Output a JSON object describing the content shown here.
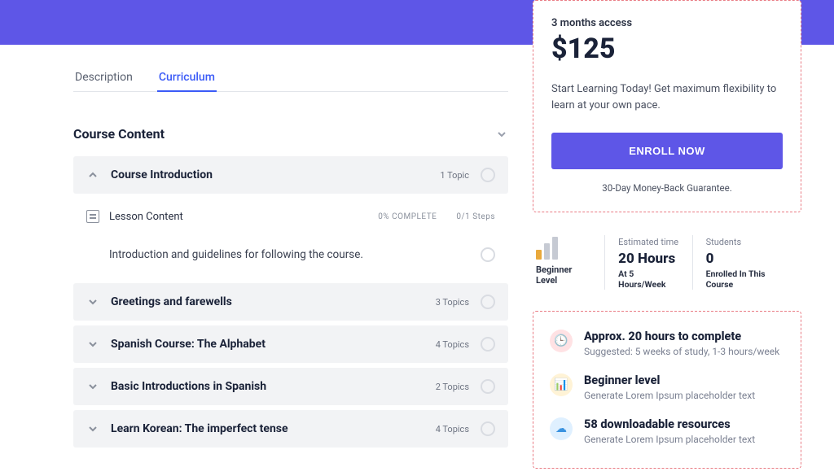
{
  "tabs": {
    "description": "Description",
    "curriculum": "Curriculum"
  },
  "course_content": {
    "heading": "Course Content",
    "lesson_header": "Lesson Content",
    "lesson_progress": "0% COMPLETE",
    "lesson_steps": "0/1 Steps",
    "intro_text": "Introduction and guidelines for following the course.",
    "modules": [
      {
        "title": "Course Introduction",
        "meta": "1 Topic",
        "open": true
      },
      {
        "title": "Greetings and farewells",
        "meta": "3 Topics",
        "open": false
      },
      {
        "title": "Spanish Course: The Alphabet",
        "meta": "4 Topics",
        "open": false
      },
      {
        "title": "Basic Introductions in Spanish",
        "meta": "2 Topics",
        "open": false
      },
      {
        "title": "Learn Korean: The imperfect tense",
        "meta": "4 Topics",
        "open": false
      }
    ]
  },
  "pricing": {
    "access": "3 months access",
    "price": "$125",
    "blurb": "Start Learning Today! Get maximum flexibility to learn at your own pace.",
    "cta": "ENROLL NOW",
    "guarantee": "30-Day Money-Back Guarantee."
  },
  "stats": {
    "level_label": "Beginner Level",
    "est_label": "Estimated time",
    "est_value": "20 Hours",
    "est_sub": "At 5 Hours/Week",
    "students_label": "Students",
    "students_value": "0",
    "students_sub": "Enrolled In This Course"
  },
  "highlights": [
    {
      "title": "Approx. 20 hours to complete",
      "sub": "Suggested: 5 weeks of study, 1-3 hours/week",
      "color": "pink",
      "glyph": "🕒"
    },
    {
      "title": "Beginner level",
      "sub": "Generate Lorem Ipsum placeholder text",
      "color": "yellow",
      "glyph": "📊"
    },
    {
      "title": "58 downloadable resources",
      "sub": "Generate Lorem Ipsum placeholder text",
      "color": "blue",
      "glyph": "☁"
    }
  ]
}
